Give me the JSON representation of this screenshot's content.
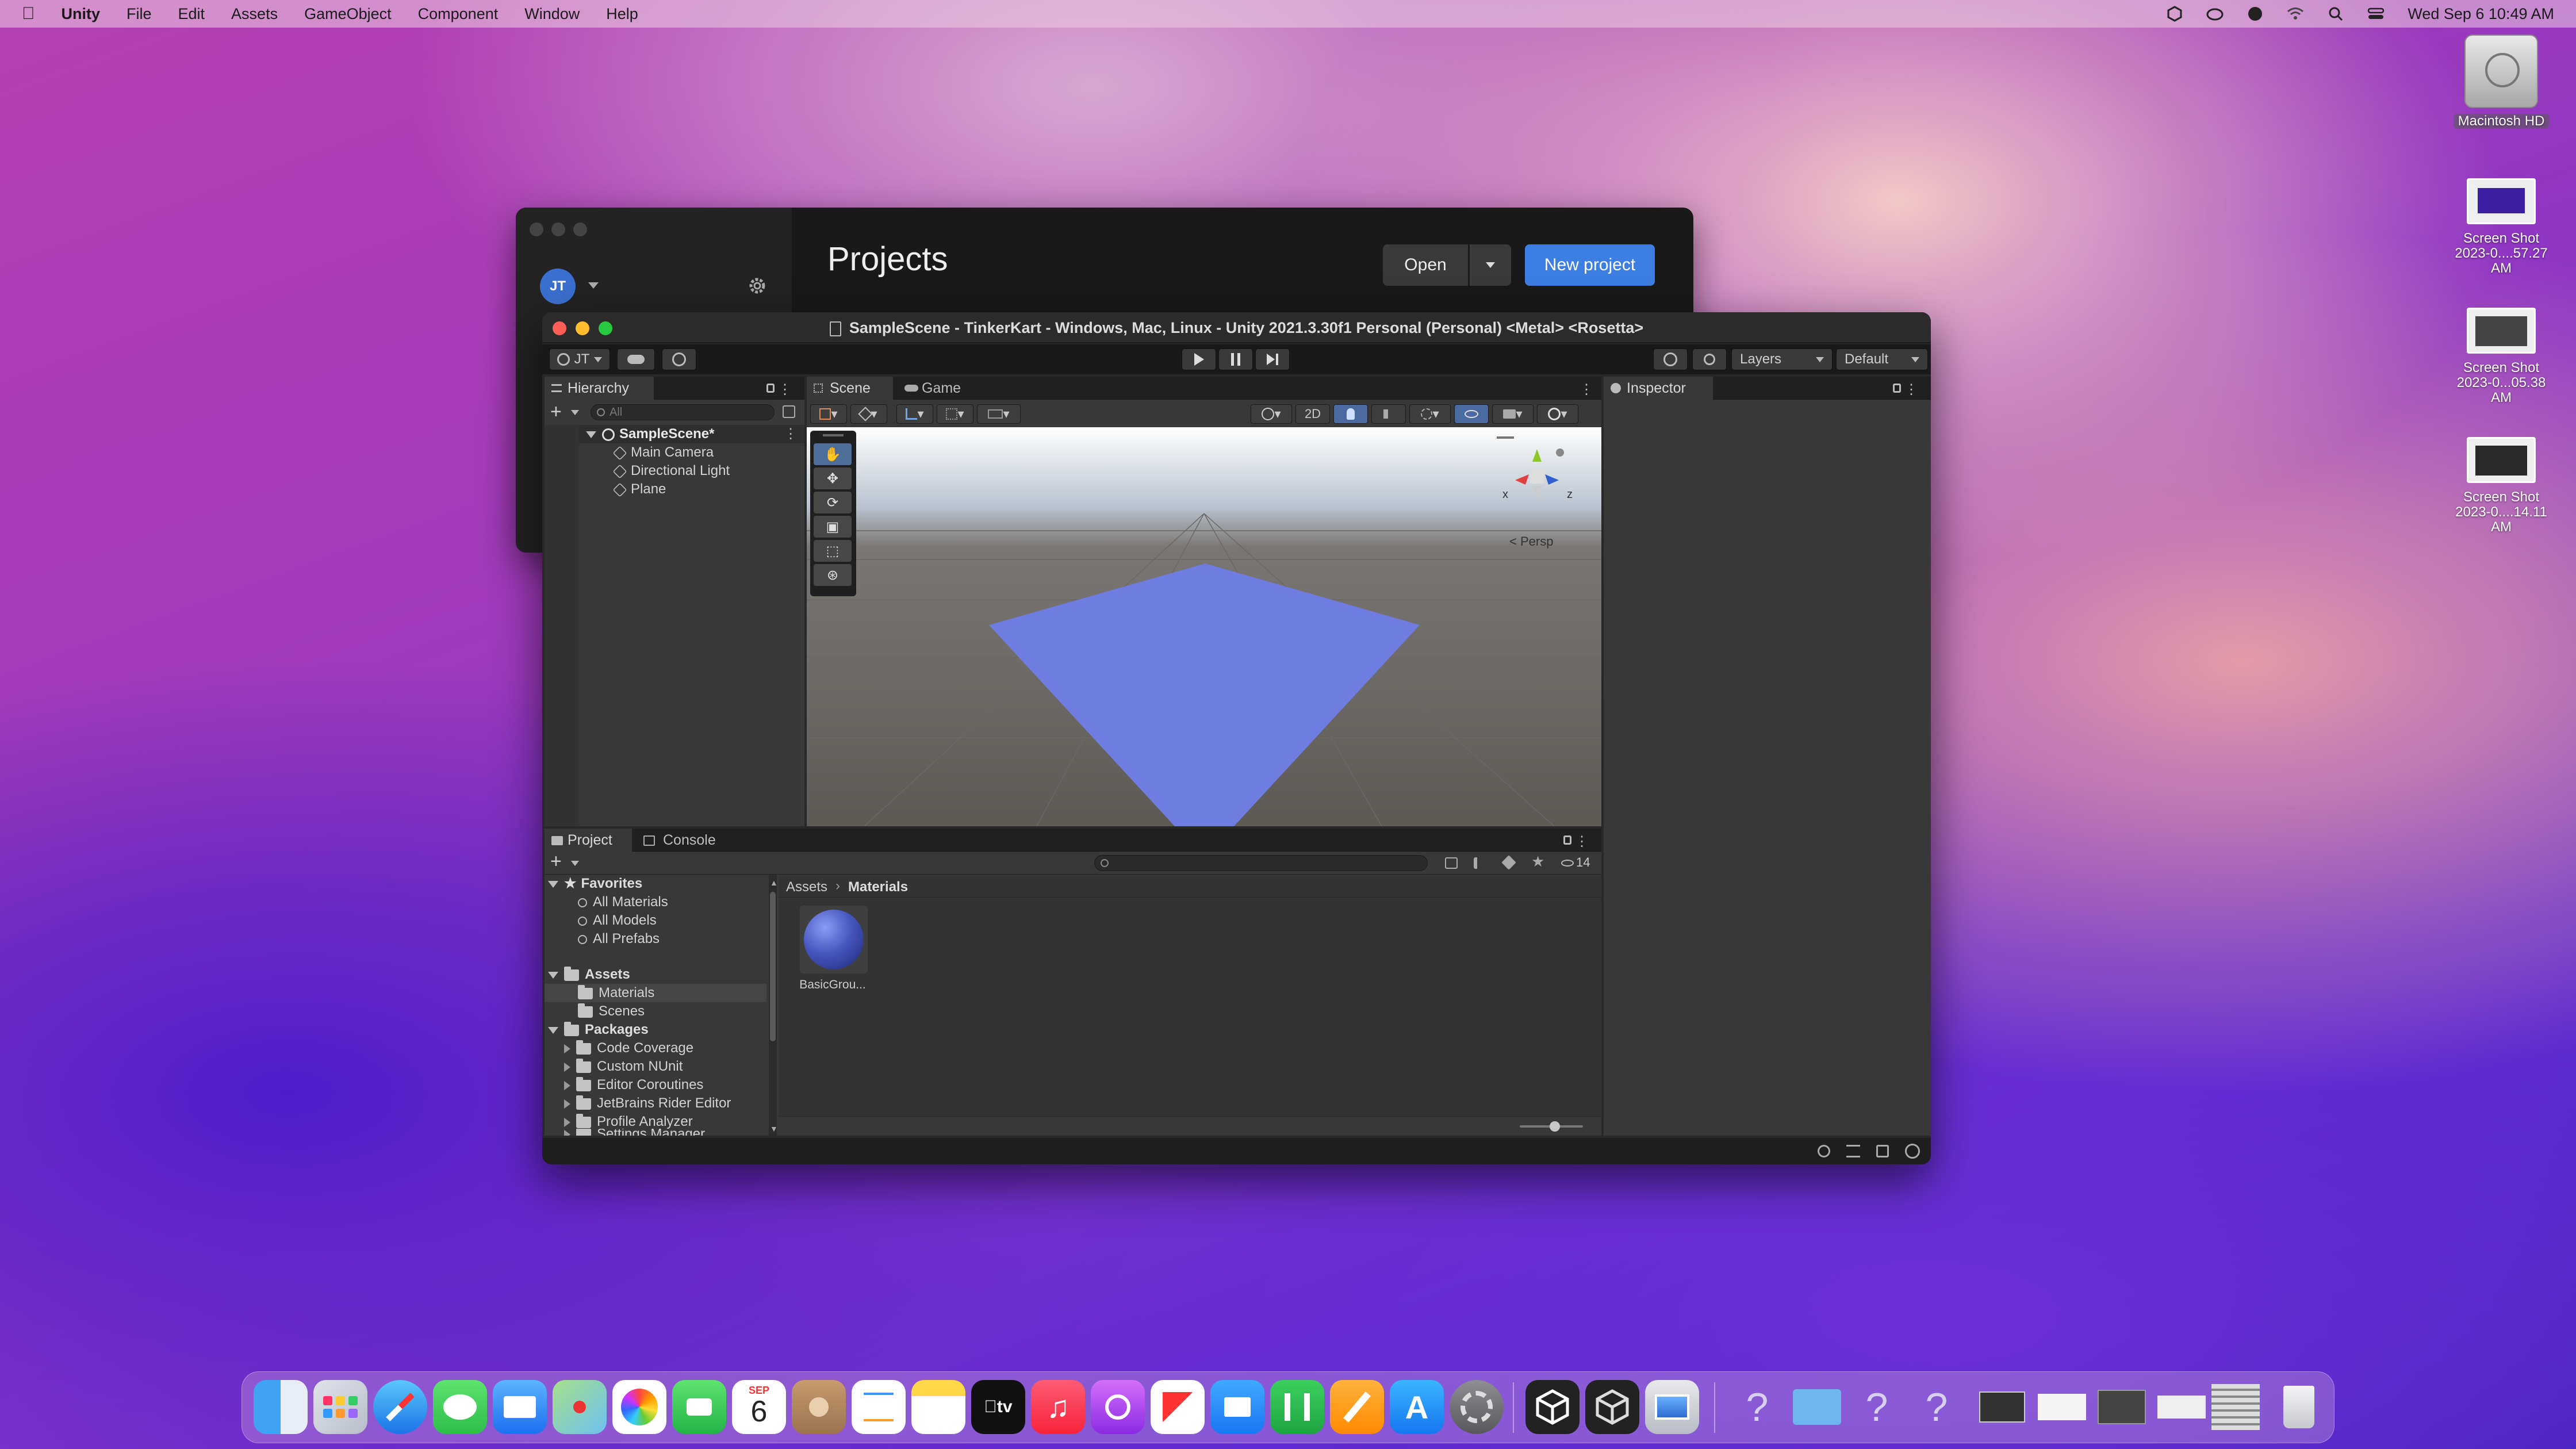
{
  "menubar": {
    "app": "Unity",
    "items": [
      "File",
      "Edit",
      "Assets",
      "GameObject",
      "Component",
      "Window",
      "Help"
    ],
    "datetime": "Wed Sep 6  10:49 AM"
  },
  "desktop": {
    "items": [
      {
        "label": "Macintosh HD"
      },
      {
        "label": "Screen Shot\n2023-0....57.27 AM"
      },
      {
        "label": "Screen Shot\n2023-0...05.38 AM"
      },
      {
        "label": "Screen Shot\n2023-0....14.11 AM"
      }
    ]
  },
  "hub": {
    "title": "Projects",
    "avatar": "JT",
    "open_label": "Open",
    "new_project_label": "New project"
  },
  "editor": {
    "title": "SampleScene - TinkerKart - Windows, Mac, Linux - Unity 2021.3.30f1 Personal (Personal) <Metal> <Rosetta>",
    "account": "JT",
    "layers_label": "Layers",
    "layout_label": "Default",
    "hierarchy": {
      "tab": "Hierarchy",
      "search_placeholder": "All",
      "scene": "SampleScene*",
      "objects": [
        "Main Camera",
        "Directional Light",
        "Plane"
      ]
    },
    "scene_view": {
      "tab_scene": "Scene",
      "tab_game": "Game",
      "mode_2d": "2D",
      "persp_label": "< Persp",
      "axis_x": "x",
      "axis_z": "z",
      "plane_color": "#6f7de0"
    },
    "inspector": {
      "tab": "Inspector"
    },
    "project": {
      "tab_project": "Project",
      "tab_console": "Console",
      "favorites_label": "Favorites",
      "favorites": [
        "All Materials",
        "All Models",
        "All Prefabs"
      ],
      "assets_label": "Assets",
      "assets": [
        "Materials",
        "Scenes"
      ],
      "packages_label": "Packages",
      "packages": [
        "Code Coverage",
        "Custom NUnit",
        "Editor Coroutines",
        "JetBrains Rider Editor",
        "Profile Analyzer",
        "Settings Manager"
      ],
      "breadcrumb": [
        "Assets",
        "Materials"
      ],
      "hidden_count": "14",
      "asset_items": [
        {
          "label": "BasicGrou..."
        }
      ]
    }
  },
  "dock": {
    "calendar_month": "SEP",
    "calendar_day": "6",
    "apps": [
      "Finder",
      "Launchpad",
      "Safari",
      "Messages",
      "Mail",
      "Maps",
      "Photos",
      "FaceTime",
      "Calendar",
      "Contacts",
      "Reminders",
      "Notes",
      "TV",
      "Music",
      "Podcasts",
      "News",
      "Keynote",
      "Numbers",
      "Pages",
      "App Store",
      "System Preferences",
      "Unity Hub",
      "Unity",
      "Preview"
    ]
  }
}
